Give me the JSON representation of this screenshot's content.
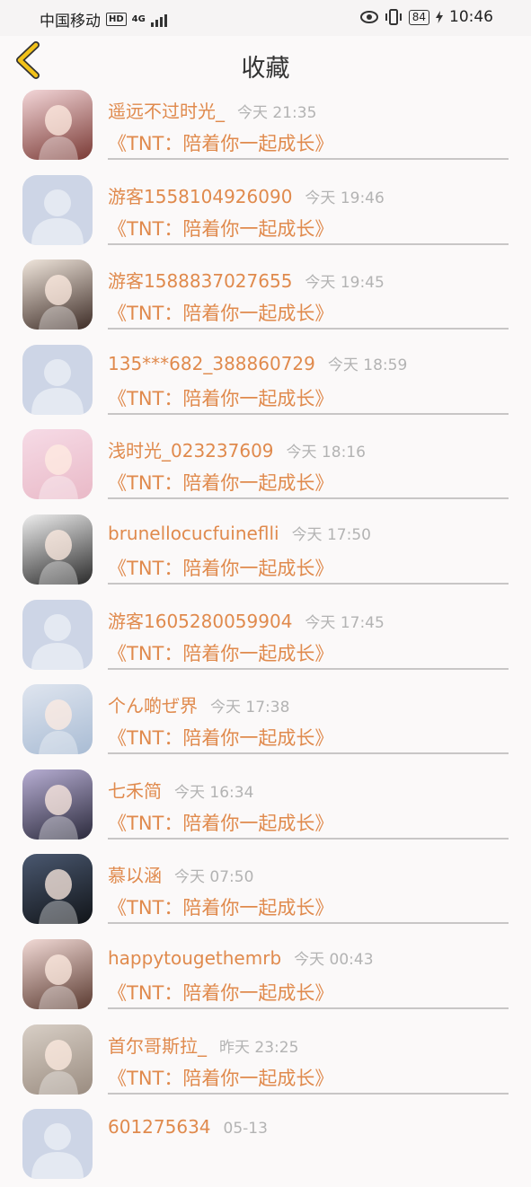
{
  "status_bar": {
    "carrier": "中国移动",
    "hd": "HD",
    "network": "4G",
    "battery": "84",
    "time": "10:46"
  },
  "header": {
    "title": "收藏",
    "accent_color": "#f2c21a"
  },
  "favorites": [
    {
      "name": "遥远不过时光_",
      "time": "今天 21:35",
      "book": "《TNT：陪着你一起成长》",
      "avatar": "photo"
    },
    {
      "name": "游客1558104926090",
      "time": "今天 19:46",
      "book": "《TNT：陪着你一起成长》",
      "avatar": "default"
    },
    {
      "name": "游客1588837027655",
      "time": "今天 19:45",
      "book": "《TNT：陪着你一起成长》",
      "avatar": "photo"
    },
    {
      "name": "135***682_388860729",
      "time": "今天 18:59",
      "book": "《TNT：陪着你一起成长》",
      "avatar": "default"
    },
    {
      "name": "浅时光_023237609",
      "time": "今天 18:16",
      "book": "《TNT：陪着你一起成长》",
      "avatar": "photo"
    },
    {
      "name": "brunellocucfuineflli",
      "time": "今天 17:50",
      "book": "《TNT：陪着你一起成长》",
      "avatar": "photo"
    },
    {
      "name": "游客1605280059904",
      "time": "今天 17:45",
      "book": "《TNT：陪着你一起成长》",
      "avatar": "default"
    },
    {
      "name": "个ん啲ぜ界",
      "time": "今天 17:38",
      "book": "《TNT：陪着你一起成长》",
      "avatar": "photo"
    },
    {
      "name": "七禾简",
      "time": "今天 16:34",
      "book": "《TNT：陪着你一起成长》",
      "avatar": "photo"
    },
    {
      "name": "慕以涵",
      "time": "今天 07:50",
      "book": "《TNT：陪着你一起成长》",
      "avatar": "photo"
    },
    {
      "name": "happytougethemrb",
      "time": "今天 00:43",
      "book": "《TNT：陪着你一起成长》",
      "avatar": "photo"
    },
    {
      "name": "首尔哥斯拉_",
      "time": "昨天 23:25",
      "book": "《TNT：陪着你一起成长》",
      "avatar": "photo"
    },
    {
      "name": "601275634",
      "time": "05-13",
      "book": "",
      "avatar": "default"
    }
  ]
}
